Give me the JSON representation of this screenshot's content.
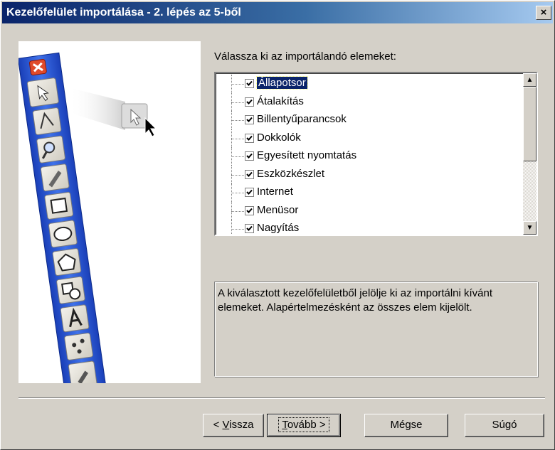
{
  "window": {
    "title": "Kezelőfelület importálása - 2. lépés az 5-ből",
    "close_glyph": "×"
  },
  "prompt": "Válassza ki az importálandó elemeket:",
  "items": [
    {
      "label": "Állapotsor",
      "checked": true,
      "selected": true
    },
    {
      "label": "Átalakítás",
      "checked": true,
      "selected": false
    },
    {
      "label": "Billentyűparancsok",
      "checked": true,
      "selected": false
    },
    {
      "label": "Dokkolók",
      "checked": true,
      "selected": false
    },
    {
      "label": "Egyesített nyomtatás",
      "checked": true,
      "selected": false
    },
    {
      "label": "Eszközkészlet",
      "checked": true,
      "selected": false
    },
    {
      "label": "Internet",
      "checked": true,
      "selected": false
    },
    {
      "label": "Menüsor",
      "checked": true,
      "selected": false
    },
    {
      "label": "Nagyítás",
      "checked": true,
      "selected": false
    }
  ],
  "scroll": {
    "up_glyph": "▲",
    "down_glyph": "▼"
  },
  "description": "A kiválasztott kezelőfelületből jelölje ki az importálni kívánt elemeket. Alapértelmezésként az összes elem kijelölt.",
  "buttons": {
    "back": {
      "mnemonic": "V",
      "rest": "issza",
      "prefix": "< "
    },
    "next": {
      "mnemonic": "T",
      "rest": "ovább >"
    },
    "cancel": "Mégse",
    "help": "Súgó"
  },
  "colors": {
    "title_start": "#0a246a",
    "title_end": "#a6caf0",
    "toolbar_blue": "#1f4fd0",
    "close_red": "#e04a2a"
  }
}
